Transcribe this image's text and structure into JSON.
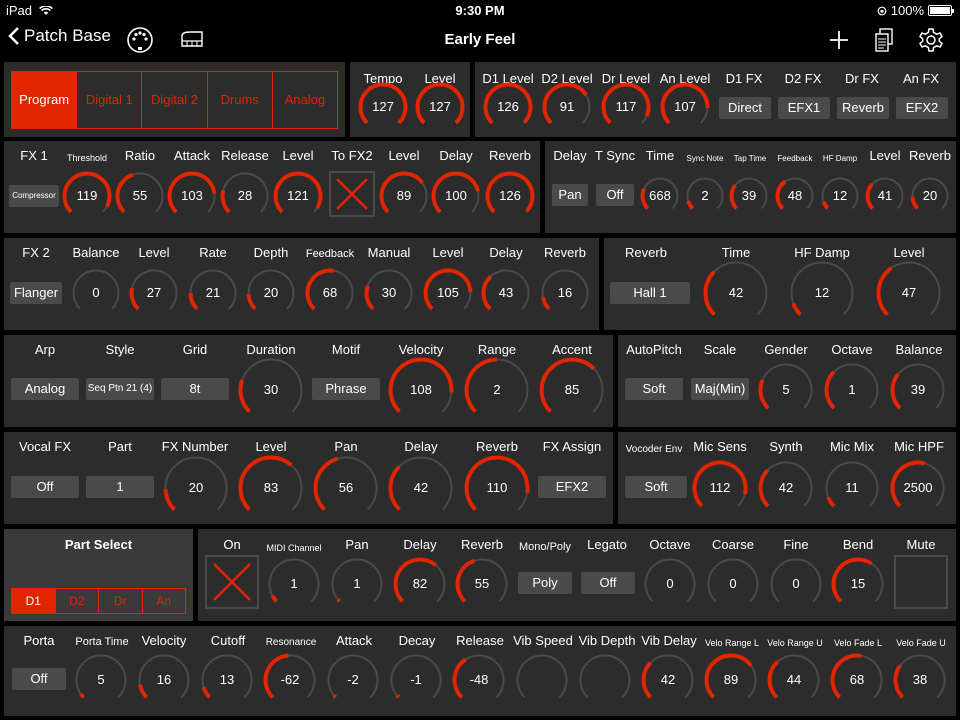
{
  "status": {
    "device": "iPad",
    "time": "9:30 PM",
    "battery": "100%"
  },
  "nav": {
    "back_label": "Patch Base",
    "title": "Early Feel"
  },
  "program": {
    "tabs": [
      "Program",
      "Digital 1",
      "Digital 2",
      "Drums",
      "Analog"
    ]
  },
  "tempo": {
    "tempo_label": "Tempo",
    "tempo_value": "127",
    "level_label": "Level",
    "level_value": "127"
  },
  "levels": {
    "d1_label": "D1 Level",
    "d1_value": "126",
    "d2_label": "D2 Level",
    "d2_value": "91",
    "dr_label": "Dr Level",
    "dr_value": "117",
    "an_label": "An Level",
    "an_value": "107",
    "d1fx_label": "D1 FX",
    "d1fx_value": "Direct",
    "d2fx_label": "D2 FX",
    "d2fx_value": "EFX1",
    "drfx_label": "Dr FX",
    "drfx_value": "Reverb",
    "anfx_label": "An FX",
    "anfx_value": "EFX2"
  },
  "fx1": {
    "title": "FX 1",
    "type": "Compressor",
    "threshold_label": "Threshold",
    "threshold": "119",
    "ratio_label": "Ratio",
    "ratio": "55",
    "attack_label": "Attack",
    "attack": "103",
    "release_label": "Release",
    "release": "28",
    "level_label": "Level",
    "level": "121",
    "tofx2_label": "To FX2",
    "level2_label": "Level",
    "level2": "89",
    "delay_label": "Delay",
    "delay": "100",
    "reverb_label": "Reverb",
    "reverb": "126"
  },
  "delay": {
    "title": "Delay",
    "type": "Pan",
    "tsync_label": "T Sync",
    "tsync": "Off",
    "time_label": "Time",
    "time": "668",
    "syncnote_label": "Sync Note",
    "syncnote": "2",
    "taptime_label": "Tap Time",
    "taptime": "39",
    "feedback_label": "Feedback",
    "feedback": "48",
    "hfdamp_label": "HF Damp",
    "hfdamp": "12",
    "level_label": "Level",
    "level": "41",
    "reverb_label": "Reverb",
    "reverb": "20"
  },
  "fx2": {
    "title": "FX 2",
    "type": "Flanger",
    "balance_label": "Balance",
    "balance": "0",
    "level_label": "Level",
    "level": "27",
    "rate_label": "Rate",
    "rate": "21",
    "depth_label": "Depth",
    "depth": "20",
    "feedback_label": "Feedback",
    "feedback": "68",
    "manual_label": "Manual",
    "manual": "30",
    "level2_label": "Level",
    "level2": "105",
    "delay_label": "Delay",
    "delay": "43",
    "reverb_label": "Reverb",
    "reverb": "16"
  },
  "reverb": {
    "title": "Reverb",
    "type": "Hall 1",
    "time_label": "Time",
    "time": "42",
    "hfdamp_label": "HF Damp",
    "hfdamp": "12",
    "level_label": "Level",
    "level": "47"
  },
  "arp": {
    "title": "Arp",
    "type": "Analog",
    "style_label": "Style",
    "style": "Seq Ptn 21 (4)",
    "grid_label": "Grid",
    "grid": "8t",
    "duration_label": "Duration",
    "duration": "30",
    "motif_label": "Motif",
    "motif": "Phrase",
    "velocity_label": "Velocity",
    "velocity": "108",
    "range_label": "Range",
    "range": "2",
    "accent_label": "Accent",
    "accent": "85"
  },
  "autopitch": {
    "title": "AutoPitch",
    "type": "Soft",
    "scale_label": "Scale",
    "scale": "Maj(Min)",
    "gender_label": "Gender",
    "gender": "5",
    "octave_label": "Octave",
    "octave": "1",
    "balance_label": "Balance",
    "balance": "39"
  },
  "vocalfx": {
    "title": "Vocal FX",
    "type": "Off",
    "part_label": "Part",
    "part": "1",
    "fxnumber_label": "FX Number",
    "fxnumber": "20",
    "level_label": "Level",
    "level": "83",
    "pan_label": "Pan",
    "pan": "56",
    "delay_label": "Delay",
    "delay": "42",
    "reverb_label": "Reverb",
    "reverb": "110",
    "fxassign_label": "FX Assign",
    "fxassign": "EFX2"
  },
  "vocoder": {
    "title": "Vocoder Env",
    "type": "Soft",
    "micsens_label": "Mic Sens",
    "micsens": "112",
    "synth_label": "Synth",
    "synth": "42",
    "micmix_label": "Mic Mix",
    "micmix": "11",
    "michpf_label": "Mic HPF",
    "michpf": "2500"
  },
  "partselect": {
    "title": "Part Select",
    "tabs": [
      "D1",
      "D2",
      "Dr",
      "An"
    ]
  },
  "part": {
    "on_label": "On",
    "midich_label": "MIDI Channel",
    "midich": "1",
    "pan_label": "Pan",
    "pan": "1",
    "delay_label": "Delay",
    "delay": "82",
    "reverb_label": "Reverb",
    "reverb": "55",
    "monopoly_label": "Mono/Poly",
    "monopoly": "Poly",
    "legato_label": "Legato",
    "legato": "Off",
    "octave_label": "Octave",
    "octave": "0",
    "coarse_label": "Coarse",
    "coarse": "0",
    "fine_label": "Fine",
    "fine": "0",
    "bend_label": "Bend",
    "bend": "15",
    "mute_label": "Mute"
  },
  "porta": {
    "title": "Porta",
    "type": "Off",
    "portatime_label": "Porta Time",
    "portatime": "5",
    "velocity_label": "Velocity",
    "velocity": "16",
    "cutoff_label": "Cutoff",
    "cutoff": "13",
    "resonance_label": "Resonance",
    "resonance": "-62",
    "attack_label": "Attack",
    "attack": "-2",
    "decay_label": "Decay",
    "decay": "-1",
    "release_label": "Release",
    "release": "-48",
    "vibspeed_label": "Vib Speed",
    "vibspeed": "",
    "vibdepth_label": "Vib Depth",
    "vibdepth": "",
    "vibdelay_label": "Vib Delay",
    "vibdelay": "42",
    "velorangel_label": "Velo Range L",
    "velorangel": "89",
    "velorangeu_label": "Velo Range U",
    "velorangeu": "44",
    "velofadel_label": "Velo Fade L",
    "velofadel": "68",
    "velofadeu_label": "Velo Fade U",
    "velofadeu": "38"
  },
  "colors": {
    "accent": "#e02500",
    "panel": "#2c2c2c",
    "button": "#4a4a4a",
    "track": "#4a4a4a"
  }
}
